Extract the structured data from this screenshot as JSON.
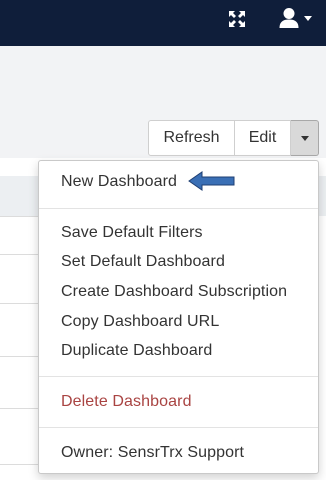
{
  "colors": {
    "topbar": "#0f1e3a",
    "toolbar_bg": "#f2f3f5",
    "text": "#333333",
    "danger": "#a94442",
    "arrow": "#3a6fb5"
  },
  "header": {
    "icons": [
      "fullscreen-icon",
      "user-icon",
      "caret-down-icon"
    ]
  },
  "toolbar": {
    "refresh_label": "Refresh",
    "edit_label": "Edit"
  },
  "dropdown": {
    "items": [
      "New Dashboard",
      "Save Default Filters",
      "Set Default Dashboard",
      "Create Dashboard Subscription",
      "Copy Dashboard URL",
      "Duplicate Dashboard",
      "Delete Dashboard",
      "Owner: SensrTrx Support"
    ]
  }
}
